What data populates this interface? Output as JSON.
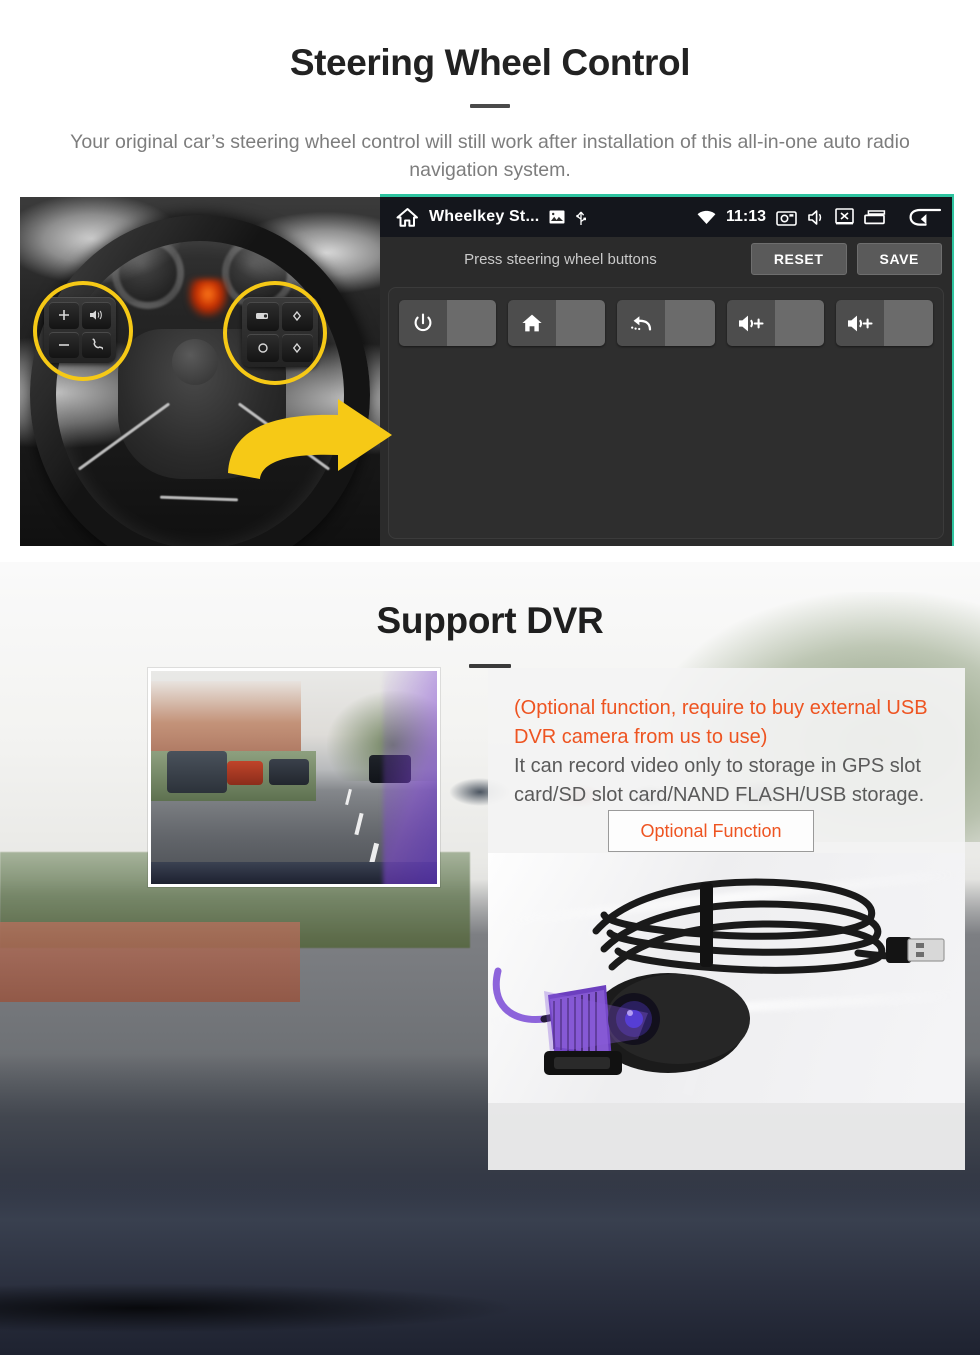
{
  "sections": {
    "steering_wheel": {
      "title": "Steering Wheel Control",
      "subtitle": "Your original car’s steering wheel control will still work after installation of this all-in-one auto radio navigation system."
    },
    "dvr": {
      "title": "Support DVR",
      "note_orange": "(Optional function, require to buy external USB DVR camera from us to use)",
      "note_grey": "It can record video only to storage in GPS slot card/SD slot card/NAND FLASH/USB storage.",
      "optional_button": "Optional Function"
    }
  },
  "android_screen": {
    "status_bar": {
      "home_icon": "home-icon",
      "app_title": "Wheelkey St...",
      "image_icon": "image-icon",
      "usb_icon": "usb-icon",
      "wifi_icon": "wifi-icon",
      "clock": "11:13",
      "screenshot_icon": "screenshot-icon",
      "mute_icon": "mute-icon",
      "close-app_icon": "close-box-icon",
      "recents_icon": "recents-icon",
      "back_icon": "back-arrow-icon"
    },
    "toolbar": {
      "hint": "Press steering wheel buttons",
      "reset_label": "RESET",
      "save_label": "SAVE"
    },
    "key_slots": [
      {
        "icon": "power-icon",
        "value": ""
      },
      {
        "icon": "home-icon",
        "value": ""
      },
      {
        "icon": "back-icon",
        "value": ""
      },
      {
        "icon": "volume-up-icon",
        "value": ""
      },
      {
        "icon": "volume-up-icon",
        "value": ""
      }
    ]
  },
  "steering_wheel_photo": {
    "left_pad_keys": [
      "volume-up-key",
      "voice-key",
      "volume-down-key",
      "phone-key"
    ],
    "right_pad_keys": [
      "media-key",
      "up-key",
      "ok-key",
      "down-key"
    ],
    "highlight_circles": 2,
    "arrow": "arrow-right-icon"
  },
  "colors": {
    "accent_teal": "#2ec4a0",
    "highlight_yellow": "#F6C916",
    "orange": "#EE5421",
    "heading_dark": "#1f1f1f",
    "subtitle_grey": "#7d7d7d",
    "android_bg": "#2b2b2b",
    "statusbar_bg": "#14161c"
  }
}
